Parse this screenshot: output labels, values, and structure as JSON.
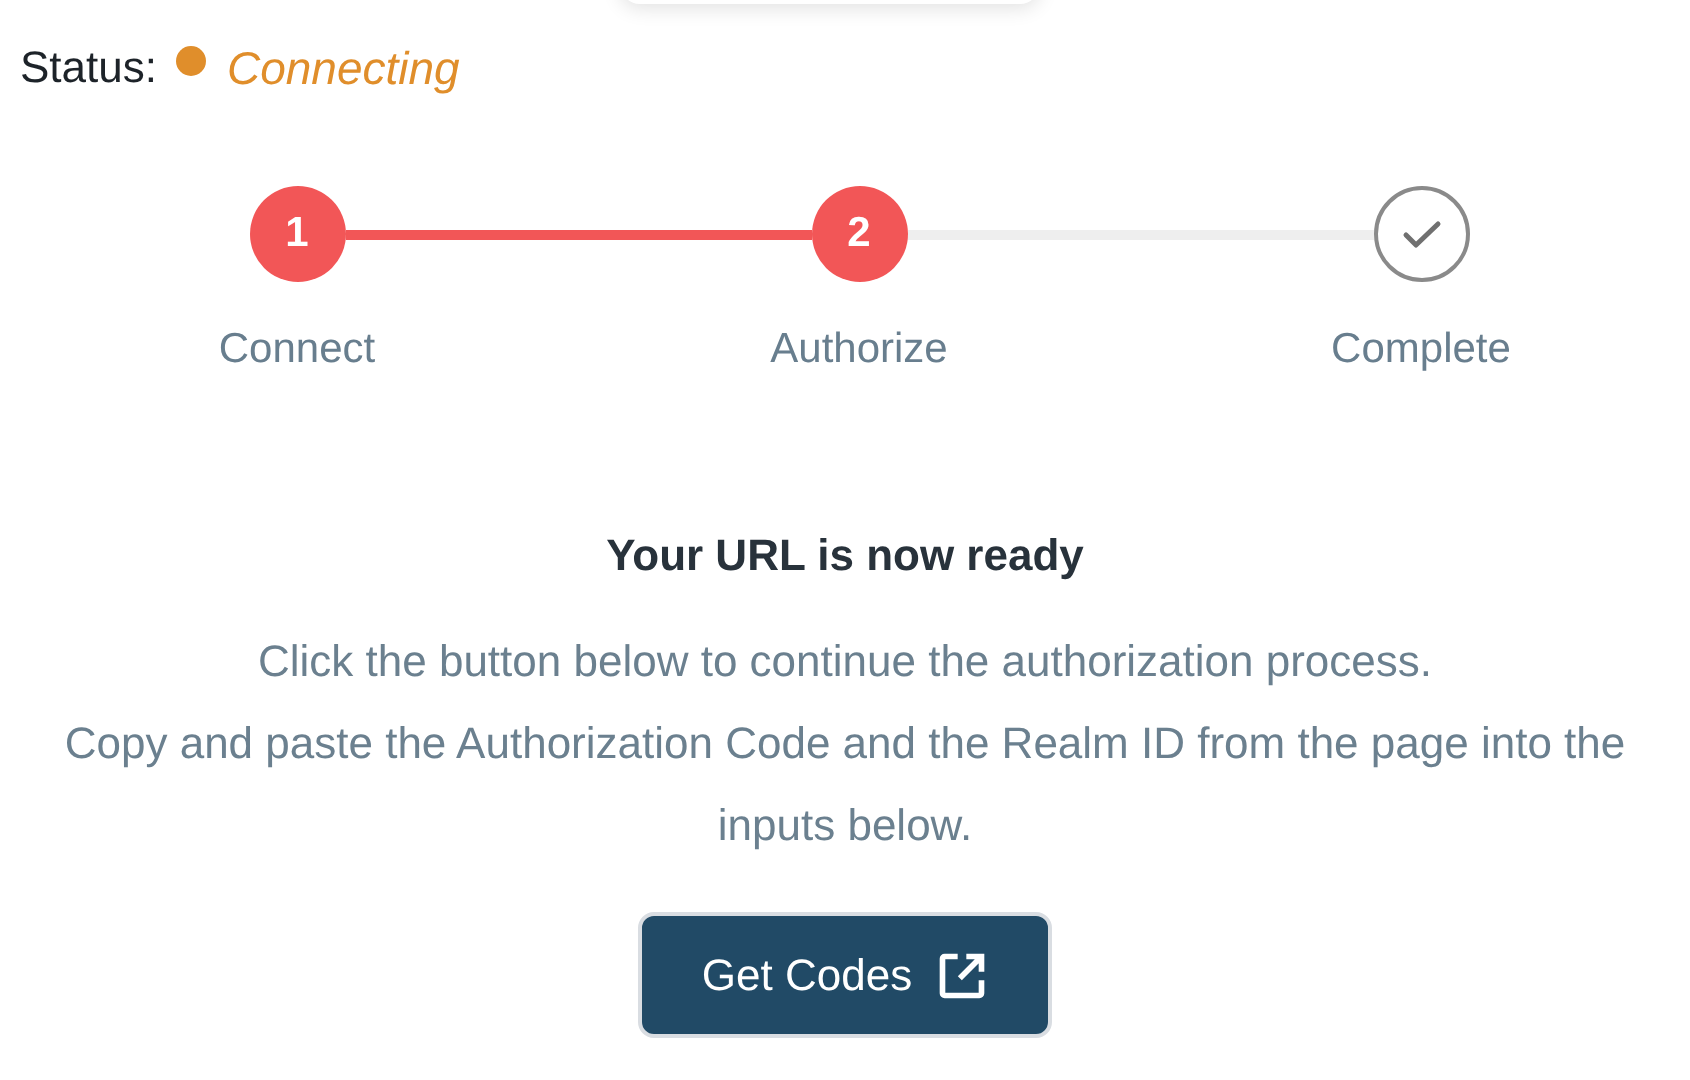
{
  "status": {
    "label": "Status:",
    "value": "Connecting",
    "color": "#e08e2b"
  },
  "steps": [
    {
      "kind": "number",
      "number": "1",
      "label": "Connect",
      "reached": true
    },
    {
      "kind": "number",
      "number": "2",
      "label": "Authorize",
      "reached": true
    },
    {
      "kind": "check",
      "label": "Complete",
      "reached": false
    }
  ],
  "title": "Your URL is now ready",
  "instructions": [
    "Click the button below to continue the authorization process.",
    "Copy and paste the Authorization Code and the Realm ID from the page into the inputs below."
  ],
  "button": {
    "label": "Get Codes"
  }
}
